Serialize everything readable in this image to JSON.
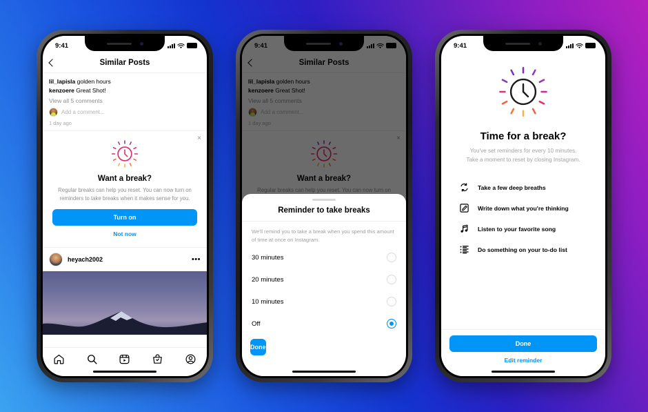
{
  "background": {
    "gradient_from": "#3ba3f0",
    "gradient_mid": "#1433cf",
    "gradient_to": "#b61fbe"
  },
  "accent_color": "#0095f6",
  "status_bar": {
    "time": "9:41"
  },
  "phone1": {
    "appbar": {
      "title": "Similar Posts",
      "back_icon": "chevron-left-icon"
    },
    "feed": {
      "comment1_user": "lil_lapisla",
      "comment1_text": " golden hours",
      "comment2_user": "kenzoere",
      "comment2_text": " Great Shot!",
      "view_all": "View all 5 comments",
      "add_comment_placeholder": "Add a comment...",
      "timestamp": "1 day ago"
    },
    "promo": {
      "close_label": "×",
      "title": "Want a break?",
      "body": "Regular breaks can help you reset. You can now turn on reminders to take breaks when it makes sense for you.",
      "primary_label": "Turn on",
      "secondary_label": "Not now"
    },
    "post": {
      "username": "heyach2002",
      "menu_label": "•••"
    },
    "tabbar": [
      "home-icon",
      "search-icon",
      "reels-icon",
      "shop-icon",
      "profile-icon"
    ]
  },
  "phone2": {
    "appbar": {
      "title": "Similar Posts",
      "back_icon": "chevron-left-icon"
    },
    "feed": {
      "comment1_user": "lil_lapisla",
      "comment1_text": " golden hours",
      "comment2_user": "kenzoere",
      "comment2_text": " Great Shot!",
      "view_all": "View all 5 comments",
      "add_comment_placeholder": "Add a comment...",
      "timestamp": "1 day ago"
    },
    "promo": {
      "close_label": "×",
      "title": "Want a break?",
      "body": "Regular breaks can help you reset. You can now turn on reminders to take breaks when it makes sense for you."
    },
    "sheet": {
      "title": "Reminder to take breaks",
      "description": "We'll remind you to take a break when you spend this amount of time at once on Instagram.",
      "options": [
        {
          "label": "30 minutes",
          "selected": false
        },
        {
          "label": "20 minutes",
          "selected": false
        },
        {
          "label": "10 minutes",
          "selected": false
        },
        {
          "label": "Off",
          "selected": true
        }
      ],
      "done_label": "Done"
    }
  },
  "phone3": {
    "title": "Time for a break?",
    "body_line1": "You've set reminders for every 10 minutes.",
    "body_line2": "Take a moment to reset by closing Instagram.",
    "tips": [
      {
        "icon": "refresh-loop-icon",
        "text": "Take a few deep breaths"
      },
      {
        "icon": "pencil-square-icon",
        "text": "Write down what you're thinking"
      },
      {
        "icon": "music-note-icon",
        "text": "Listen to your favorite song"
      },
      {
        "icon": "checklist-icon",
        "text": "Do something on your to-do list"
      }
    ],
    "done_label": "Done",
    "edit_label": "Edit reminder"
  }
}
